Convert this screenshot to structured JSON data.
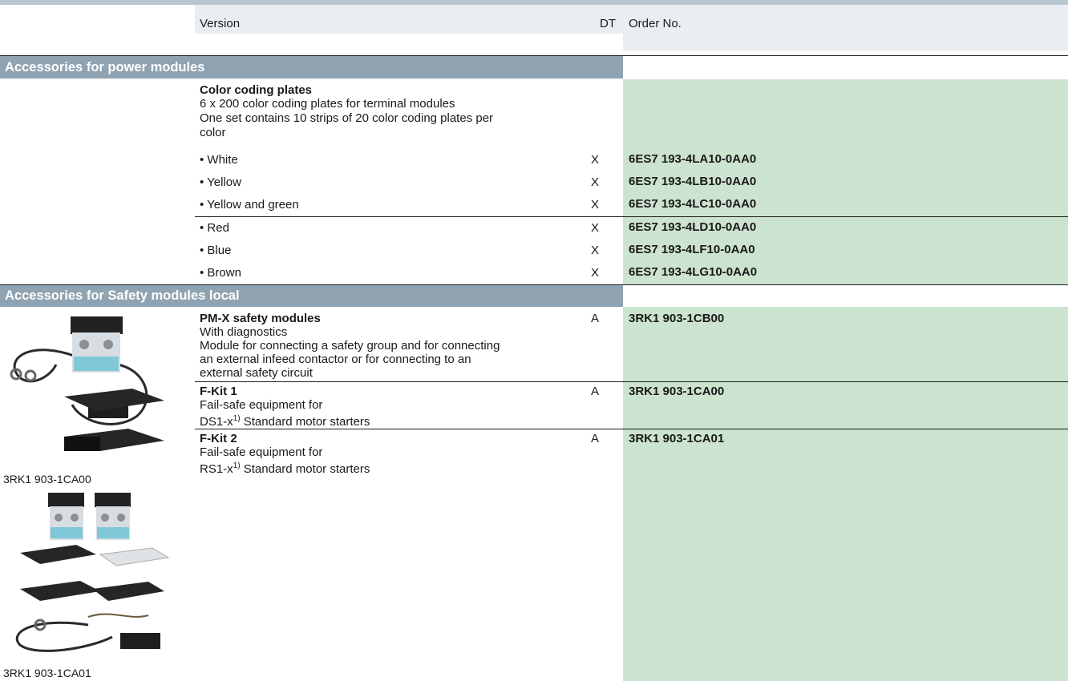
{
  "header": {
    "version": "Version",
    "dt": "DT",
    "order_no": "Order No."
  },
  "sections": [
    {
      "title": "Accessories for power modules",
      "group": {
        "title": "Color coding plates",
        "desc1": "6 x 200 color coding plates for terminal modules",
        "desc2": "One set contains 10 strips of 20 color coding plates per",
        "desc3": "color"
      },
      "items": [
        {
          "label": "• White",
          "dt": "X",
          "order": "6ES7 193-4LA10-0AA0"
        },
        {
          "label": "• Yellow",
          "dt": "X",
          "order": "6ES7 193-4LB10-0AA0"
        },
        {
          "label": "• Yellow and green",
          "dt": "X",
          "order": "6ES7 193-4LC10-0AA0"
        },
        {
          "label": "• Red",
          "dt": "X",
          "order": "6ES7 193-4LD10-0AA0"
        },
        {
          "label": "• Blue",
          "dt": "X",
          "order": "6ES7 193-4LF10-0AA0"
        },
        {
          "label": "• Brown",
          "dt": "X",
          "order": "6ES7 193-4LG10-0AA0"
        }
      ]
    },
    {
      "title": "Accessories for Safety modules local",
      "products": [
        {
          "title": "PM-X safety modules",
          "lines": [
            "With diagnostics",
            "Module for connecting a safety group and for connecting",
            "an external infeed contactor or for connecting to an",
            "external safety circuit"
          ],
          "dt": "A",
          "order": "3RK1 903-1CB00"
        },
        {
          "title": "F-Kit 1",
          "line1": "Fail-safe equipment for",
          "prefix": "DS1-x",
          "sup": "1)",
          "suffix": " Standard motor starters",
          "dt": "A",
          "order": "3RK1 903-1CA00"
        },
        {
          "title": "F-Kit 2",
          "line1": "Fail-safe equipment for",
          "prefix": "RS1-x",
          "sup": "1)",
          "suffix": " Standard motor starters",
          "dt": "A",
          "order": "3RK1 903-1CA01"
        }
      ],
      "image_captions": [
        "3RK1 903-1CA00",
        "3RK1 903-1CA01"
      ]
    }
  ],
  "colors": {
    "section_bar": "#8fa3b2",
    "order_green": "#cce3cf",
    "header_bg": "#e8eef2"
  }
}
